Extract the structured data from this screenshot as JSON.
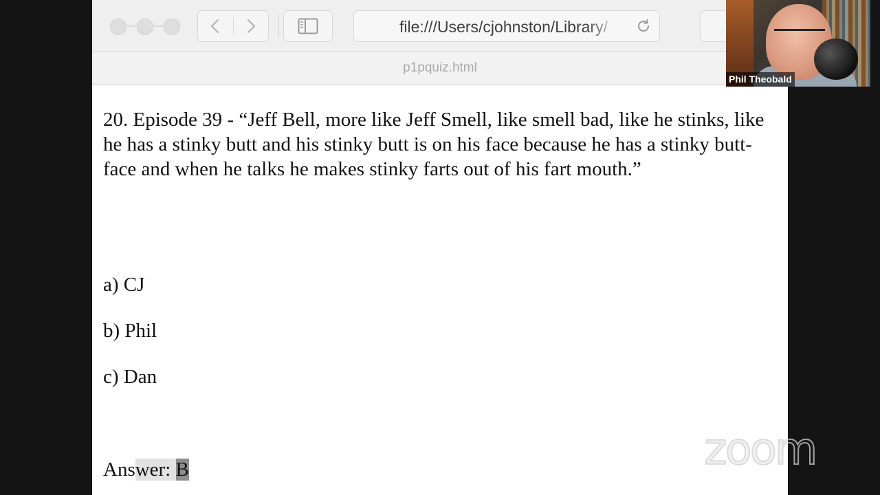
{
  "browser": {
    "url": "file:///Users/cjohnston/Library/",
    "tab_title": "p1pquiz.html"
  },
  "quiz": {
    "question": "20. Episode 39 - “Jeff Bell, more like Jeff Smell, like smell bad, like he stinks, like he has a stinky butt and his stinky butt is on his face because he has a stinky butt-face and when he talks he makes stinky farts out of his fart mouth.”",
    "options": [
      {
        "label": "a) CJ"
      },
      {
        "label": "b) Phil"
      },
      {
        "label": "c) Dan"
      }
    ],
    "answer_prefix": "Ans",
    "answer_selected": "wer: ",
    "answer_value": "B"
  },
  "webcam": {
    "participant_name": "Phil Theobald"
  },
  "watermark": "zoom",
  "icons": {
    "back": "chevron-left-icon",
    "forward": "chevron-right-icon",
    "sidebar": "sidebar-icon",
    "reload": "reload-icon"
  }
}
